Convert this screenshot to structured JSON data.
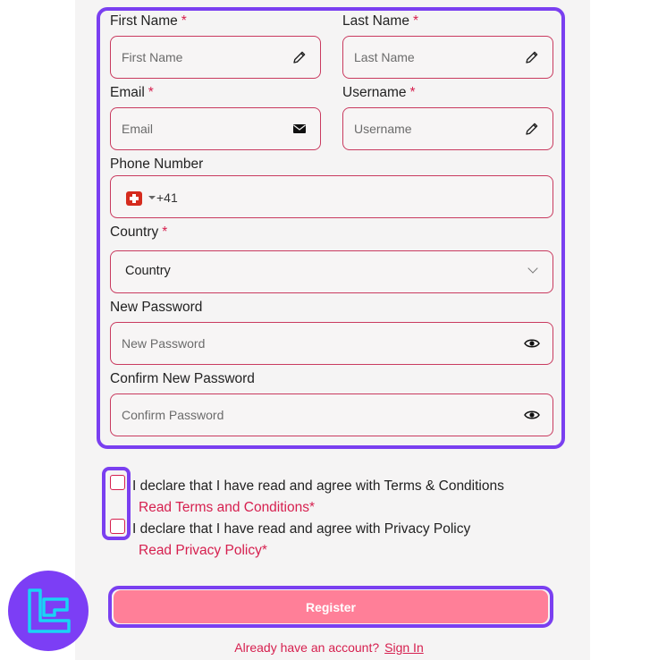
{
  "form": {
    "first_name": {
      "label": "First Name",
      "required_mark": "*",
      "placeholder": "First Name",
      "icon": "pencil-icon"
    },
    "last_name": {
      "label": "Last Name",
      "required_mark": "*",
      "placeholder": "Last Name",
      "icon": "pencil-icon"
    },
    "email": {
      "label": "Email",
      "required_mark": "*",
      "placeholder": "Email",
      "icon": "envelope-icon"
    },
    "username": {
      "label": "Username",
      "required_mark": "*",
      "placeholder": "Username",
      "icon": "pencil-icon"
    },
    "phone": {
      "label": "Phone Number",
      "dial_code": "+41",
      "flag": "switzerland-flag-icon"
    },
    "country": {
      "label": "Country",
      "required_mark": "*",
      "selected": "Country",
      "icon": "chevron-down-icon"
    },
    "new_password": {
      "label": "New Password",
      "placeholder": "New Password",
      "icon": "eye-icon"
    },
    "confirm_password": {
      "label": "Confirm New Password",
      "placeholder": "Confirm Password",
      "icon": "eye-icon"
    }
  },
  "agreements": {
    "terms_text": "I declare that I have read and agree with Terms & Conditions",
    "terms_link": "Read Terms and Conditions*",
    "privacy_text": "I declare that I have read and agree with Privacy Policy",
    "privacy_link": "Read Privacy Policy*"
  },
  "register_label": "Register",
  "footer": {
    "text": "Already have an account?",
    "link": "Sign In"
  },
  "colors": {
    "accent": "#d6204f",
    "highlight": "#7a3ff0",
    "button": "#ff7f98",
    "logo": "#7c3ef5",
    "logo_mark": "#19d4f5"
  }
}
